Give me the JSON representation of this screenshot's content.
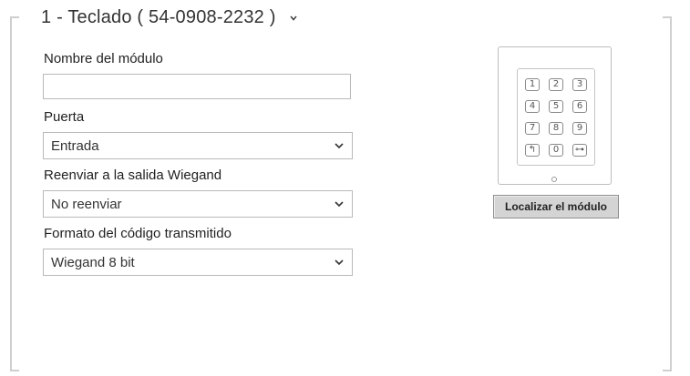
{
  "module": {
    "title": "1 - Teclado ( 54-0908-2232 )",
    "title_icon": "chevron-down-icon"
  },
  "form": {
    "name_label": "Nombre del módulo",
    "name_value": "",
    "door_label": "Puerta",
    "door_value": "Entrada",
    "wiegand_label": "Reenviar a la salida Wiegand",
    "wiegand_value": "No reenviar",
    "format_label": "Formato del código transmitido",
    "format_value": "Wiegand 8 bit"
  },
  "device": {
    "keys": [
      "1",
      "2",
      "3",
      "4",
      "5",
      "6",
      "7",
      "8",
      "9",
      "↰",
      "0",
      "⊶"
    ],
    "locate_label": "Localizar el módulo"
  }
}
